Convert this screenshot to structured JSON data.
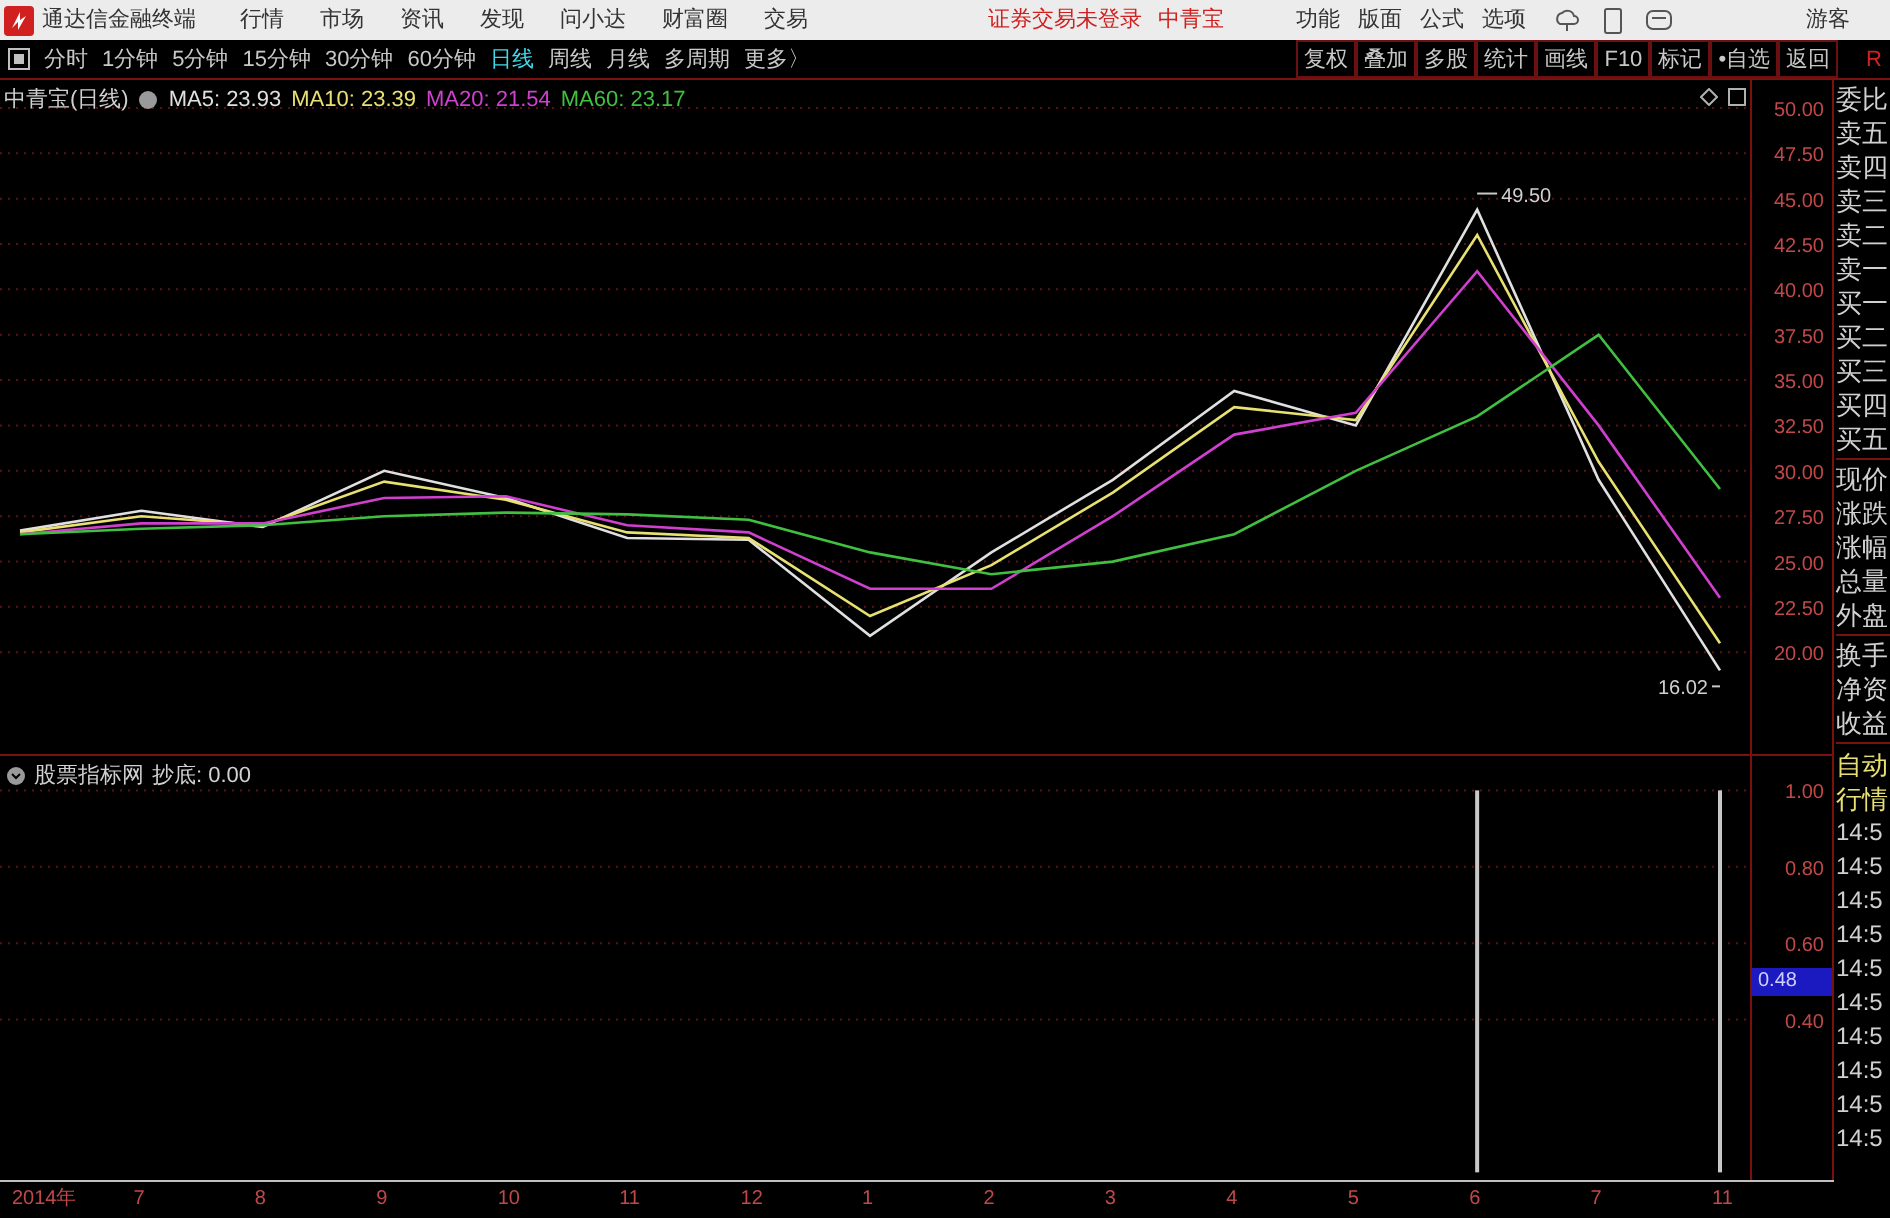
{
  "menu_bar": {
    "app_title": "通达信金融终端",
    "items": [
      "行情",
      "市场",
      "资讯",
      "发现",
      "问小达",
      "财富圈",
      "交易"
    ],
    "notice": "证券交易未登录",
    "stock": "中青宝",
    "right_items": [
      "功能",
      "版面",
      "公式",
      "选项"
    ],
    "user": "游客"
  },
  "toolbar": {
    "periods": [
      {
        "label": "分时",
        "selected": false
      },
      {
        "label": "1分钟",
        "selected": false
      },
      {
        "label": "5分钟",
        "selected": false
      },
      {
        "label": "15分钟",
        "selected": false
      },
      {
        "label": "30分钟",
        "selected": false
      },
      {
        "label": "60分钟",
        "selected": false
      },
      {
        "label": "日线",
        "selected": true
      },
      {
        "label": "周线",
        "selected": false
      },
      {
        "label": "月线",
        "selected": false
      },
      {
        "label": "多周期",
        "selected": false
      },
      {
        "label": "更多〉",
        "selected": false
      }
    ],
    "buttons": [
      "复权",
      "叠加",
      "多股",
      "统计",
      "画线",
      "F10",
      "标记",
      "•自选",
      "返回"
    ],
    "corner": "R"
  },
  "main_chart": {
    "title": "中青宝(日线)",
    "readouts": [
      ": 23.93",
      ": 23.39",
      ": 21.54",
      ": 23.17"
    ],
    "chart_data": {
      "type": "line",
      "series": [
        {
          "name": "MA5",
          "color": "#e0e0e0",
          "values": [
            26.7,
            27.8,
            26.9,
            30.0,
            28.5,
            26.3,
            26.2,
            20.9,
            25.5,
            29.5,
            34.4,
            32.5,
            44.4,
            29.5,
            19.0
          ]
        },
        {
          "name": "MA10",
          "color": "#e8e070",
          "values": [
            26.6,
            27.5,
            27.0,
            29.4,
            28.4,
            26.6,
            26.3,
            22.0,
            24.8,
            28.8,
            33.5,
            32.8,
            43.0,
            30.5,
            20.5
          ]
        },
        {
          "name": "MA20",
          "color": "#d040d0",
          "values": [
            26.5,
            27.1,
            27.1,
            28.5,
            28.6,
            27.0,
            26.6,
            23.5,
            23.5,
            27.5,
            32.0,
            33.2,
            41.0,
            32.5,
            23.0
          ]
        },
        {
          "name": "MA60",
          "color": "#40c040",
          "values": [
            26.5,
            26.8,
            27.0,
            27.5,
            27.7,
            27.6,
            27.3,
            25.5,
            24.3,
            25.0,
            26.5,
            30.0,
            33.0,
            37.5,
            29.0
          ]
        }
      ],
      "ylim": [
        14.28,
        51.54
      ],
      "grid": true,
      "yticks": [
        {
          "value": 50,
          "label": "50.00"
        },
        {
          "value": 47.5,
          "label": "47.50"
        },
        {
          "value": 45,
          "label": "45.00"
        },
        {
          "value": 42.5,
          "label": "42.50"
        },
        {
          "value": 40,
          "label": "40.00"
        },
        {
          "value": 37.5,
          "label": "37.50"
        },
        {
          "value": 35,
          "label": "35.00"
        },
        {
          "value": 32.5,
          "label": "32.50"
        },
        {
          "value": 30,
          "label": "30.00"
        },
        {
          "value": 27.5,
          "label": "27.50"
        },
        {
          "value": 25,
          "label": "25.00"
        },
        {
          "value": 22.5,
          "label": "22.50"
        },
        {
          "value": 20,
          "label": "20.00"
        }
      ],
      "annotations": [
        "49.50",
        "16.02"
      ]
    }
  },
  "indicator_panel": {
    "title": "股票指标网",
    "reading": ": 0.00",
    "cursor_value": "0.48",
    "chart_data": {
      "type": "bar",
      "categories": [
        "2014年",
        "7",
        "8",
        "9",
        "10",
        "11",
        "12",
        "1",
        "2",
        "3",
        "4",
        "5",
        "6",
        "7",
        "11"
      ],
      "series": [
        {
          "name": "抄底",
          "color": "#c8c8c8",
          "values": [
            0,
            0,
            0,
            0,
            0,
            0,
            0,
            0,
            0,
            0,
            0,
            0,
            1,
            0,
            1
          ]
        }
      ],
      "ylim": [
        -0.02,
        1.09
      ],
      "grid": true,
      "yticks": [
        {
          "value": 1,
          "label": "1.00"
        },
        {
          "value": 0.8,
          "label": "0.80"
        },
        {
          "value": 0.6,
          "label": "0.60"
        },
        {
          "value": 0.4,
          "label": "0.40"
        }
      ]
    }
  },
  "side_panel": {
    "groups": [
      [
        "委比",
        "卖五",
        "卖四",
        "卖三",
        "卖二",
        "卖一",
        "买一",
        "买二",
        "买三",
        "买四",
        "买五"
      ],
      [
        "现价",
        "涨跌",
        "涨幅",
        "总量",
        "外盘"
      ],
      [
        "换手",
        "净资",
        "收益"
      ]
    ],
    "auto": [
      "自动",
      "行情"
    ],
    "times": [
      "14:5",
      "14:5",
      "14:5",
      "14:5",
      "14:5",
      "14:5",
      "14:5",
      "14:5",
      "14:5",
      "14:5"
    ]
  }
}
